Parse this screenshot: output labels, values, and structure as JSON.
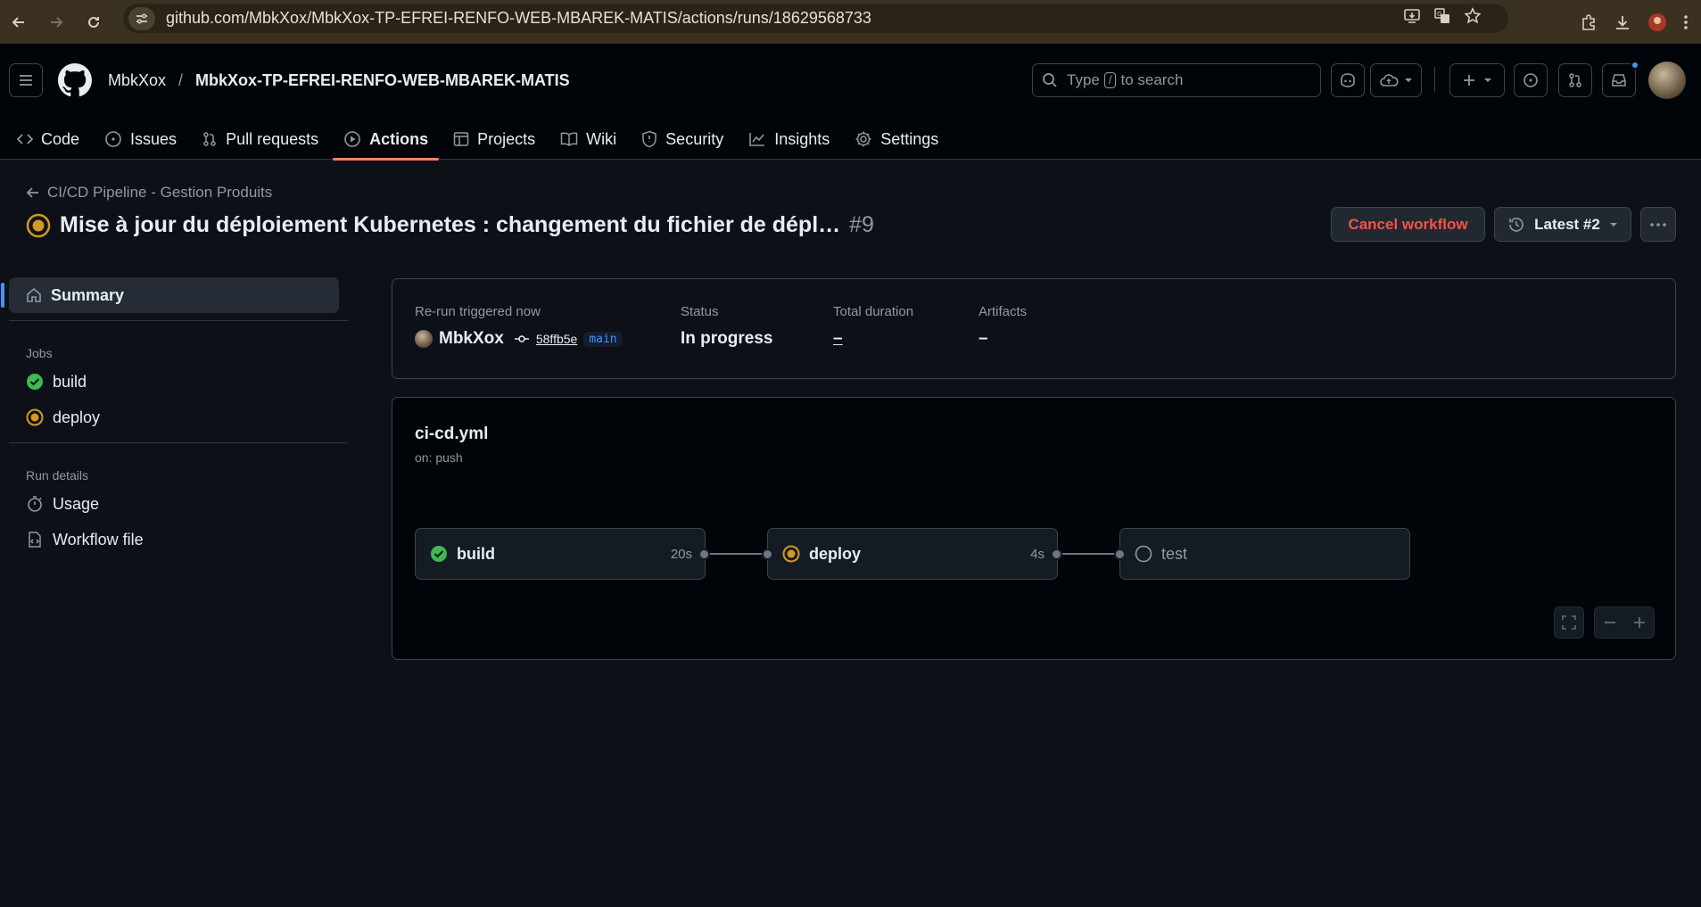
{
  "browser": {
    "url": "github.com/MbkXox/MbkXox-TP-EFREI-RENFO-WEB-MBAREK-MATIS/actions/runs/18629568733"
  },
  "header": {
    "owner": "MbkXox",
    "separator": "/",
    "repo": "MbkXox-TP-EFREI-RENFO-WEB-MBAREK-MATIS",
    "search": {
      "prefix": "Type",
      "key": "/",
      "suffix": "to search"
    }
  },
  "tabs": [
    {
      "label": "Code",
      "icon": "code-icon"
    },
    {
      "label": "Issues",
      "icon": "issue-icon"
    },
    {
      "label": "Pull requests",
      "icon": "pull-request-icon"
    },
    {
      "label": "Actions",
      "icon": "play-icon",
      "active": true
    },
    {
      "label": "Projects",
      "icon": "table-icon"
    },
    {
      "label": "Wiki",
      "icon": "book-icon"
    },
    {
      "label": "Security",
      "icon": "shield-icon"
    },
    {
      "label": "Insights",
      "icon": "graph-icon"
    },
    {
      "label": "Settings",
      "icon": "gear-icon"
    }
  ],
  "page": {
    "back_label": "CI/CD Pipeline - Gestion Produits",
    "title": "Mise à jour du déploiement Kubernetes : changement du fichier de dépl…",
    "run_number": "#9",
    "cancel_label": "Cancel workflow",
    "latest_label": "Latest #2"
  },
  "sidebar": {
    "summary": "Summary",
    "jobs_heading": "Jobs",
    "jobs": [
      {
        "label": "build",
        "status": "success"
      },
      {
        "label": "deploy",
        "status": "in_progress"
      }
    ],
    "run_details_heading": "Run details",
    "details": [
      {
        "label": "Usage",
        "icon": "stopwatch-icon"
      },
      {
        "label": "Workflow file",
        "icon": "file-code-icon"
      }
    ]
  },
  "summary": {
    "trigger_label": "Re-run triggered now",
    "actor": "MbkXox",
    "commit": "58ffb5e",
    "branch": "main",
    "status_label": "Status",
    "status_value": "In progress",
    "duration_label": "Total duration",
    "duration_value": "–",
    "artifacts_label": "Artifacts",
    "artifacts_value": "–"
  },
  "workflow": {
    "file": "ci-cd.yml",
    "trigger": "on: push",
    "jobs": [
      {
        "name": "build",
        "duration": "20s",
        "status": "success"
      },
      {
        "name": "deploy",
        "duration": "4s",
        "status": "in_progress"
      },
      {
        "name": "test",
        "duration": "",
        "status": "pending"
      }
    ]
  },
  "colors": {
    "success": "#3fb950",
    "in_progress": "#d29922",
    "danger": "#f85149",
    "accent": "#4493f8",
    "tab_underline": "#f78166"
  }
}
